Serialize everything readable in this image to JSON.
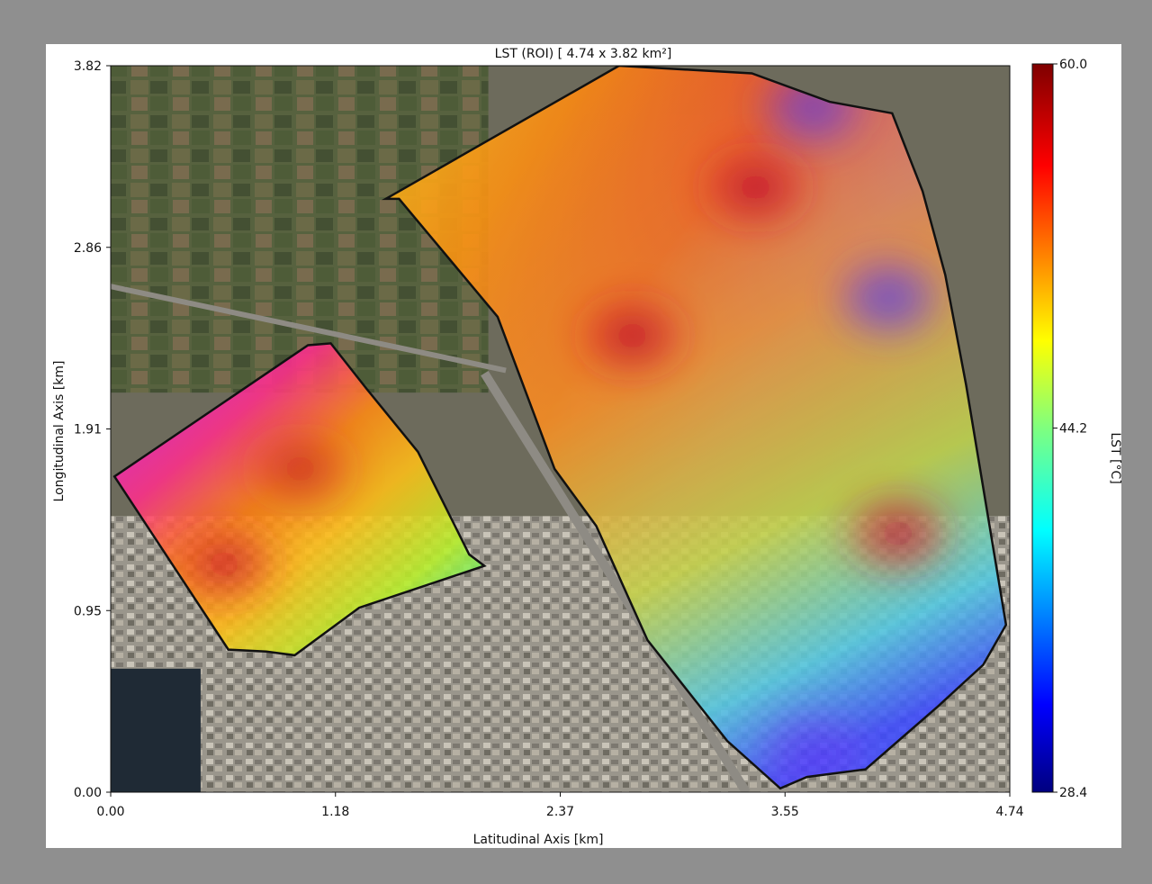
{
  "chart_data": {
    "type": "heatmap",
    "title": "LST (ROI) [ 4.74 x 3.82 km²]",
    "xlabel": "Latitudinal Axis [km]",
    "ylabel": "Longitudinal Axis [km]",
    "xlim": [
      0,
      4.74
    ],
    "ylim": [
      0,
      3.82
    ],
    "xticks": [
      "0.00",
      "1.18",
      "2.37",
      "3.55",
      "4.74"
    ],
    "yticks": [
      "0.00",
      "0.95",
      "1.91",
      "2.86",
      "3.82"
    ],
    "colorbar": {
      "label": "LST [°C]",
      "min": 28.4,
      "max": 60.0,
      "ticks": [
        "60.0",
        "44.2",
        "28.4"
      ],
      "colormap": "jet"
    },
    "regions": [
      {
        "id": "west-roi",
        "polygon_km": [
          [
            0.02,
            1.66
          ],
          [
            1.04,
            2.35
          ],
          [
            1.16,
            2.36
          ],
          [
            1.35,
            2.12
          ],
          [
            1.62,
            1.79
          ],
          [
            1.89,
            1.25
          ],
          [
            1.97,
            1.19
          ],
          [
            1.31,
            0.97
          ],
          [
            0.97,
            0.72
          ],
          [
            0.82,
            0.74
          ],
          [
            0.62,
            0.75
          ]
        ],
        "hotspots": [
          {
            "center_km": [
              0.6,
              1.2
            ],
            "lst_c": 55
          },
          {
            "center_km": [
              1.0,
              1.7
            ],
            "lst_c": 50
          }
        ]
      },
      {
        "id": "east-roi",
        "polygon_km": [
          [
            1.45,
            3.12
          ],
          [
            2.68,
            3.82
          ],
          [
            3.38,
            3.78
          ],
          [
            3.79,
            3.63
          ],
          [
            4.12,
            3.57
          ],
          [
            4.28,
            3.16
          ],
          [
            4.4,
            2.72
          ],
          [
            4.51,
            2.14
          ],
          [
            4.72,
            0.88
          ],
          [
            4.6,
            0.67
          ],
          [
            4.36,
            0.45
          ],
          [
            3.98,
            0.12
          ],
          [
            3.67,
            0.08
          ],
          [
            3.53,
            0.02
          ],
          [
            3.25,
            0.27
          ],
          [
            2.83,
            0.8
          ],
          [
            2.56,
            1.4
          ],
          [
            2.34,
            1.7
          ],
          [
            2.04,
            2.5
          ],
          [
            1.52,
            3.12
          ]
        ],
        "hotspots": [
          {
            "center_km": [
              2.75,
              2.4
            ],
            "lst_c": 57
          },
          {
            "center_km": [
              3.4,
              3.18
            ],
            "lst_c": 58
          },
          {
            "center_km": [
              4.15,
              1.36
            ],
            "lst_c": 56
          },
          {
            "center_km": [
              3.7,
              3.6
            ],
            "lst_c": 33
          },
          {
            "center_km": [
              4.1,
              2.6
            ],
            "lst_c": 31
          },
          {
            "center_km": [
              3.7,
              0.2
            ],
            "lst_c": 30
          }
        ]
      }
    ]
  }
}
